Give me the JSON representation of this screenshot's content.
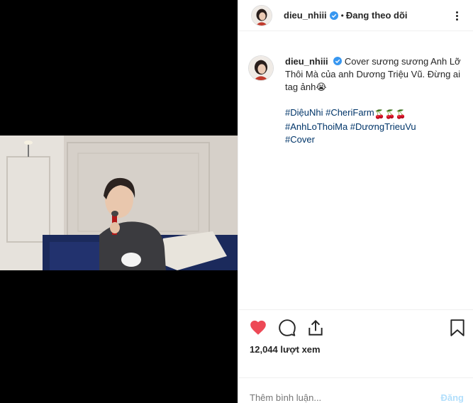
{
  "header": {
    "username": "dieu_nhiii",
    "separator": "•",
    "follow_status": "Đang theo dõi"
  },
  "caption": {
    "username": "dieu_nhiii",
    "text": "Cover sương sương Anh Lỡ Thôi Mà của anh Dương Triệu Vũ. Đừng ai tag ảnh😭",
    "tags_line1": "#DiệuNhi #CheriFarm",
    "cherries": "🍒🍒🍒",
    "tags_line2": "#AnhLoThoiMa #DươngTrieuVu",
    "tags_line3": "#Cover"
  },
  "stats": {
    "views": "12,044 lượt xem"
  },
  "comment": {
    "placeholder": "Thêm bình luận...",
    "post_label": "Đăng"
  },
  "colors": {
    "like_red": "#ed4956",
    "link_blue": "#003569",
    "verified_blue": "#3897f0",
    "post_disabled": "#b2dffc"
  },
  "icons": [
    "heart-icon",
    "comment-icon",
    "share-icon",
    "bookmark-icon",
    "verified-badge-icon",
    "more-options-icon"
  ]
}
